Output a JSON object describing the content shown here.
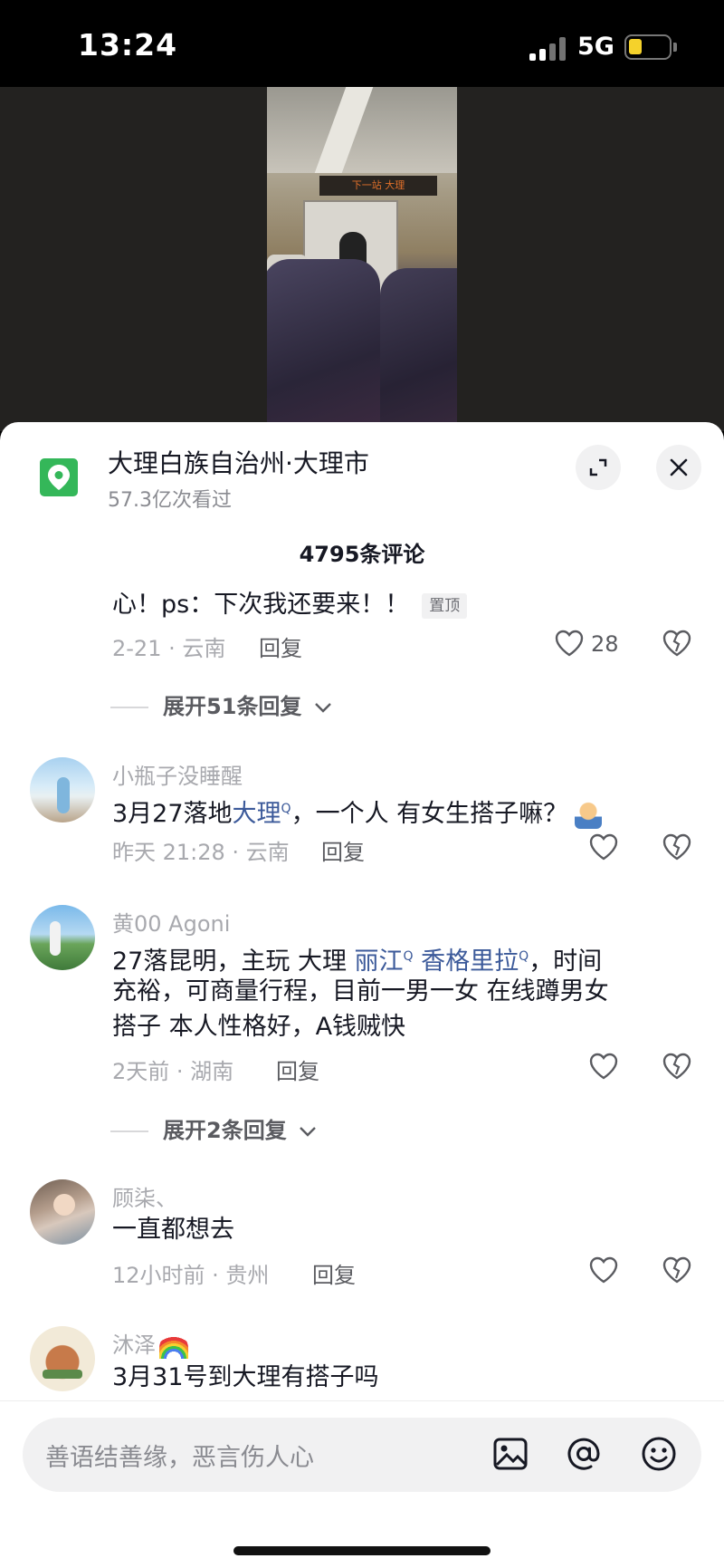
{
  "status": {
    "time": "13:24",
    "network": "5G",
    "battery_level": 0.3
  },
  "video": {
    "sign_text": "下一站 大理"
  },
  "location": {
    "name": "大理白族自治州·大理市",
    "views": "57.3亿次看过"
  },
  "comments_header": {
    "count_text": "4795条评论"
  },
  "comments": [
    {
      "text": "心！ps：下次我还要来！！",
      "pin": "置顶",
      "meta": "2-21 · 云南",
      "reply": "回复",
      "likes": "28"
    },
    {
      "expand": "展开51条回复"
    },
    {
      "user": "小瓶子没睡醒",
      "text_pre": "3月27落地",
      "link": "大理",
      "text_post": "，一个人 有女生搭子嘛？",
      "meta": "昨天 21:28 · 云南",
      "reply": "回复"
    },
    {
      "user": "黄00 Agoni",
      "text_pre": "27落昆明，主玩 大理 ",
      "link1": "丽江",
      "link2": "香格里拉",
      "text_post": "，时间",
      "line2": "充裕，可商量行程，目前一男一女 在线蹲男女",
      "line3": "搭子 本人性格好，A钱贼快",
      "meta": "2天前 · 湖南",
      "reply": "回复"
    },
    {
      "expand": "展开2条回复"
    },
    {
      "user": "顾柒、",
      "text": "一直都想去",
      "meta": "12小时前 · 贵州",
      "reply": "回复"
    },
    {
      "user": "沐泽",
      "text": "3月31号到大理有搭子吗"
    }
  ],
  "input": {
    "placeholder": "善语结善缘，恶言伤人心"
  },
  "icons": [
    "location-pin-icon",
    "expand-icon",
    "close-icon",
    "heart-icon",
    "dislike-heart-icon",
    "chevron-down-icon",
    "image-icon",
    "at-icon",
    "emoji-icon"
  ],
  "colors": {
    "link": "#3c5a9a",
    "location_icon": "#34b759",
    "muted": "#a8a9ae"
  }
}
